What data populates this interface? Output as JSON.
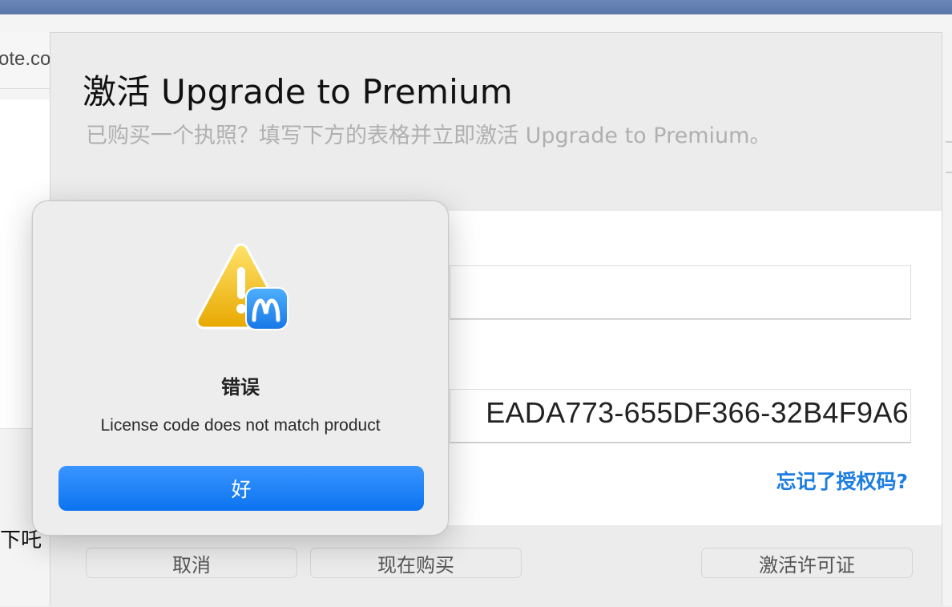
{
  "background": {
    "url_text": "ote.co",
    "side_text": "下吒"
  },
  "sheet": {
    "title": "激活 Upgrade to Premium",
    "subtitle": "已购买一个执照？填写下方的表格并立即激活 Upgrade to Premium。",
    "email_value": "",
    "license_code_value": "EADA773-655DF366-32B4F9A6",
    "forgot_link": "忘记了授权码?",
    "buttons": {
      "cancel": "取消",
      "buy_now": "现在购买",
      "activate": "激活许可证"
    }
  },
  "alert": {
    "icon": "warning-triangle-with-app-badge",
    "title": "错误",
    "message": "License code does not match product",
    "ok_button": "好"
  },
  "colors": {
    "accent": "#0b73f0",
    "link": "#1d7ee0",
    "warning_yellow": "#f2c200"
  }
}
